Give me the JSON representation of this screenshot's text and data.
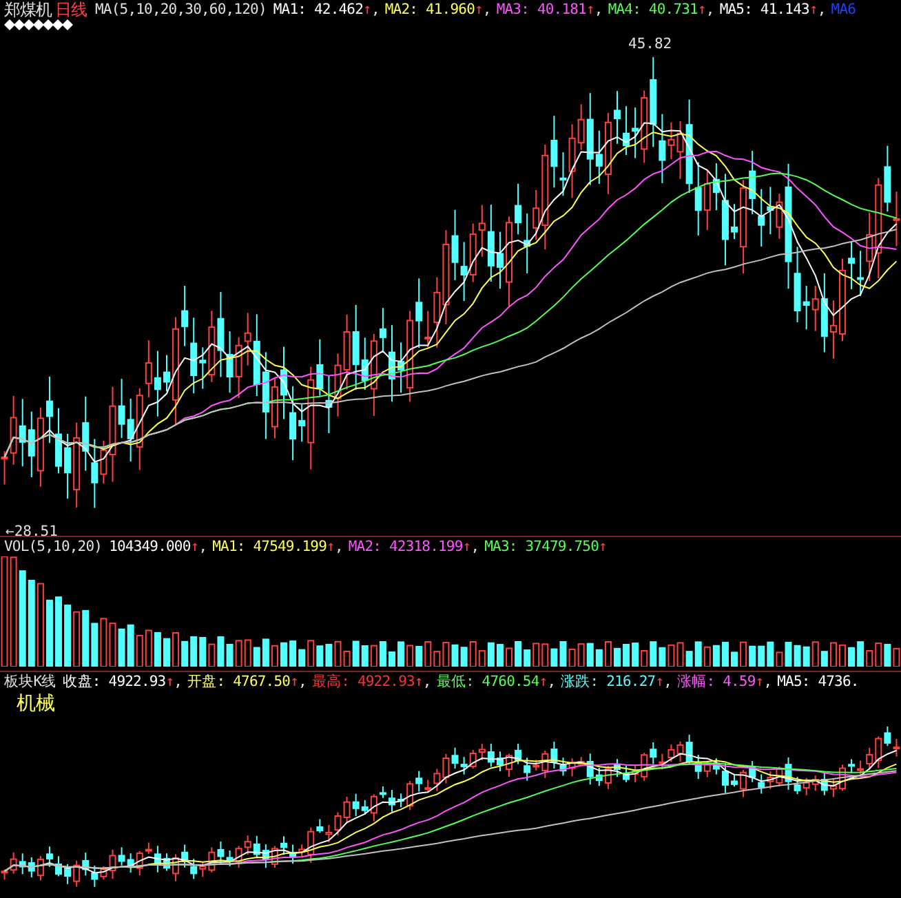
{
  "main_panel": {
    "stock_name": "郑煤机",
    "period": "日线",
    "indicator": "MA(5,10,20,30,60,120)",
    "separator": ",",
    "averages": [
      {
        "text": "MA1: 42.462",
        "arrow": "↑",
        "color": "#ffffff"
      },
      {
        "text": "MA2: 41.960",
        "arrow": "↑",
        "color": "#ffff54"
      },
      {
        "text": "MA3: 40.181",
        "arrow": "↑",
        "color": "#ff54ff"
      },
      {
        "text": "MA4: 40.731",
        "arrow": "↑",
        "color": "#54ff54"
      },
      {
        "text": "MA5: 41.143",
        "arrow": "↑",
        "color": "#ffffff"
      },
      {
        "text": "MA6",
        "color": "#2040ff"
      }
    ],
    "high_marker": "45.82",
    "low_marker": "←28.51"
  },
  "volume_panel": {
    "indicator": "VOL(5,10,20)",
    "separator": ",",
    "averages": [
      {
        "text": "104349.000",
        "arrow": "↑",
        "color": "#ffffff"
      },
      {
        "text": "MA1: 47549.199",
        "arrow": "↑",
        "color": "#ffff54"
      },
      {
        "text": "MA2: 42318.199",
        "arrow": "↑",
        "color": "#ff54ff"
      },
      {
        "text": "MA3: 37479.750",
        "arrow": "↑",
        "color": "#54ff54"
      }
    ]
  },
  "sector_panel": {
    "title": "板块K线",
    "sector_name": "机械",
    "separator": ",",
    "quotes": [
      {
        "text": "收盘: 4922.93",
        "arrow": "↑",
        "color": "#ffffff"
      },
      {
        "text": "开盘: 4767.50",
        "arrow": "↑",
        "color": "#ffff54"
      },
      {
        "text": "最高: 4922.93",
        "arrow": "↑",
        "color": "#ff3030"
      },
      {
        "text": "最低: 4760.54",
        "arrow": "↑",
        "color": "#54ff54"
      },
      {
        "text": "涨跌: 216.27",
        "arrow": "↑",
        "color": "#54ffff"
      },
      {
        "text": "涨幅: 4.59",
        "arrow": "↑",
        "color": "#ff54ff"
      },
      {
        "text": "MA5: 4736.",
        "color": "#ffffff"
      }
    ]
  }
}
